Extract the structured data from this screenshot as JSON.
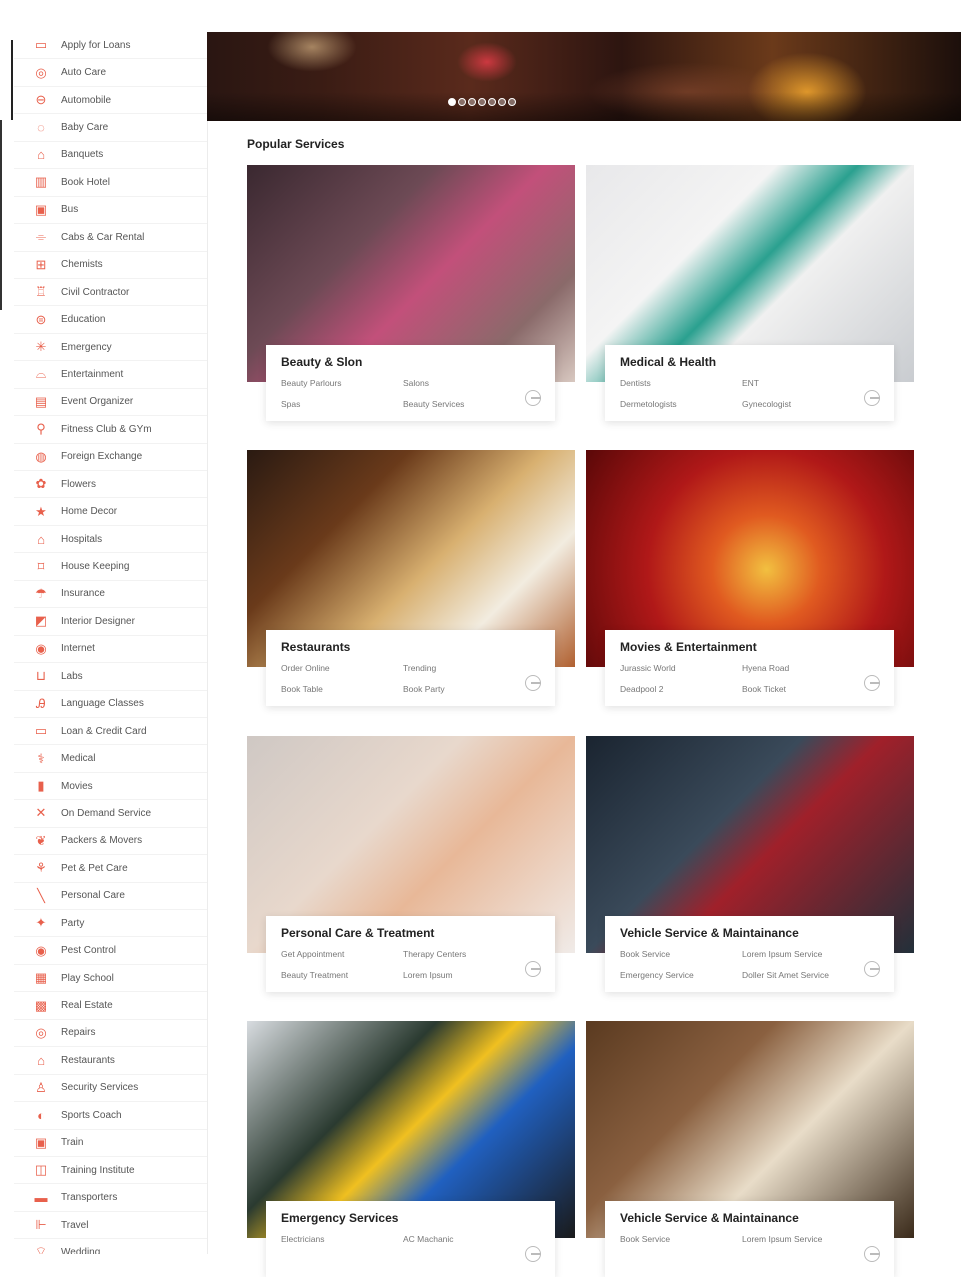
{
  "sidebar": {
    "items": [
      {
        "label": "Apply for Loans",
        "icon": "loan-icon"
      },
      {
        "label": "Auto Care",
        "icon": "auto-care-icon"
      },
      {
        "label": "Automobile",
        "icon": "car-icon"
      },
      {
        "label": "Baby Care",
        "icon": "baby-icon"
      },
      {
        "label": "Banquets",
        "icon": "banquet-icon"
      },
      {
        "label": "Book Hotel",
        "icon": "hotel-icon"
      },
      {
        "label": "Bus",
        "icon": "bus-icon"
      },
      {
        "label": "Cabs & Car Rental",
        "icon": "cab-icon"
      },
      {
        "label": "Chemists",
        "icon": "chemist-icon"
      },
      {
        "label": "Civil Contractor",
        "icon": "contractor-icon"
      },
      {
        "label": "Education",
        "icon": "education-icon"
      },
      {
        "label": "Emergency",
        "icon": "emergency-icon"
      },
      {
        "label": "Entertainment",
        "icon": "entertainment-icon"
      },
      {
        "label": "Event Organizer",
        "icon": "event-icon"
      },
      {
        "label": "Fitness Club & GYm",
        "icon": "fitness-icon"
      },
      {
        "label": "Foreign Exchange",
        "icon": "exchange-icon"
      },
      {
        "label": "Flowers",
        "icon": "flower-icon"
      },
      {
        "label": "Home Decor",
        "icon": "home-decor-icon"
      },
      {
        "label": "Hospitals",
        "icon": "hospital-icon"
      },
      {
        "label": "House Keeping",
        "icon": "housekeeping-icon"
      },
      {
        "label": "Insurance",
        "icon": "umbrella-icon"
      },
      {
        "label": "Interior Designer",
        "icon": "interior-icon"
      },
      {
        "label": "Internet",
        "icon": "globe-icon"
      },
      {
        "label": "Labs",
        "icon": "lab-icon"
      },
      {
        "label": "Language Classes",
        "icon": "language-icon"
      },
      {
        "label": "Loan & Credit Card",
        "icon": "credit-card-icon"
      },
      {
        "label": "Medical",
        "icon": "stethoscope-icon"
      },
      {
        "label": "Movies",
        "icon": "film-icon"
      },
      {
        "label": "On Demand Service",
        "icon": "tools-icon"
      },
      {
        "label": "Packers & Movers",
        "icon": "packers-icon"
      },
      {
        "label": "Pet & Pet Care",
        "icon": "pet-icon"
      },
      {
        "label": "Personal Care",
        "icon": "personal-care-icon"
      },
      {
        "label": "Party",
        "icon": "party-icon"
      },
      {
        "label": "Pest Control",
        "icon": "pest-icon"
      },
      {
        "label": "Play School",
        "icon": "play-school-icon"
      },
      {
        "label": "Real Estate",
        "icon": "real-estate-icon"
      },
      {
        "label": "Repairs",
        "icon": "repair-icon"
      },
      {
        "label": "Restaurants",
        "icon": "restaurant-icon"
      },
      {
        "label": "Security Services",
        "icon": "security-icon"
      },
      {
        "label": "Sports Coach",
        "icon": "sports-icon"
      },
      {
        "label": "Train",
        "icon": "train-icon"
      },
      {
        "label": "Training Institute",
        "icon": "training-icon"
      },
      {
        "label": "Transporters",
        "icon": "truck-icon"
      },
      {
        "label": "Travel",
        "icon": "travel-icon"
      },
      {
        "label": "Wedding",
        "icon": "wedding-icon"
      }
    ]
  },
  "hero": {
    "slide_count": 7,
    "active_slide": 1
  },
  "section": {
    "title": "Popular Services"
  },
  "cards": [
    {
      "title": "Beauty & Slon",
      "links": [
        "Beauty Parlours",
        "Salons",
        "Spas",
        "Beauty Services"
      ],
      "image": "beauty-photo"
    },
    {
      "title": "Medical & Health",
      "links": [
        "Dentists",
        "ENT",
        "Dermetologists",
        "Gynecologist"
      ],
      "image": "medical-photo"
    },
    {
      "title": "Restaurants",
      "links": [
        "Order Online",
        "Trending",
        "Book Table",
        "Book Party"
      ],
      "image": "restaurant-photo"
    },
    {
      "title": "Movies & Entertainment",
      "links": [
        "Jurassic World",
        "Hyena Road",
        "Deadpool 2",
        "Book Ticket"
      ],
      "image": "movies-photo"
    },
    {
      "title": "Personal Care & Treatment",
      "links": [
        "Get Appointment",
        "Therapy Centers",
        "Beauty Treatment",
        "Lorem Ipsum"
      ],
      "image": "personal-care-photo"
    },
    {
      "title": "Vehicle Service & Maintainance",
      "links": [
        "Book Service",
        "Lorem Ipsum Service",
        "Emergency Service",
        "Doller Sit Amet Service"
      ],
      "image": "vehicle-photo"
    },
    {
      "title": "Emergency Services",
      "links": [
        "Electricians",
        "AC Machanic",
        "",
        ""
      ],
      "image": "electrical-photo"
    },
    {
      "title": "Vehicle Service & Maintainance",
      "links": [
        "Book Service",
        "Lorem Ipsum Service",
        "",
        ""
      ],
      "image": "interior-photo"
    }
  ],
  "colors": {
    "accent": "#e8604c",
    "sidebar_text": "#555555",
    "title": "#222222"
  }
}
